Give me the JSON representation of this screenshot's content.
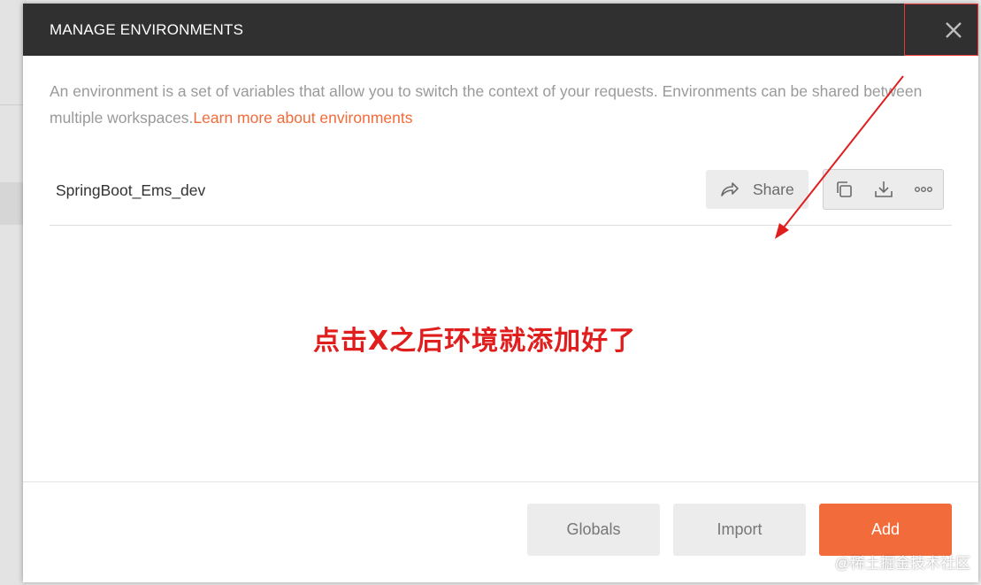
{
  "modal": {
    "title": "MANAGE ENVIRONMENTS",
    "description": "An environment is a set of variables that allow you to switch the context of your requests. Environments can be shared between multiple workspaces.",
    "learn_more_link": "Learn more about environments"
  },
  "environments": [
    {
      "name": "SpringBoot_Ems_dev",
      "share_label": "Share"
    }
  ],
  "icons": {
    "close": "close-icon",
    "share": "share-arrow-icon",
    "duplicate": "duplicate-icon",
    "download": "download-icon",
    "more": "more-options-icon"
  },
  "annotation": {
    "text": "点击X之后环境就添加好了",
    "color": "#e01e1e"
  },
  "footer": {
    "globals_label": "Globals",
    "import_label": "Import",
    "add_label": "Add"
  },
  "colors": {
    "accent": "#f26b3a",
    "header_bg": "#303030",
    "annotation_red": "#e01e1e"
  },
  "watermark": "@稀土掘金技术社区"
}
